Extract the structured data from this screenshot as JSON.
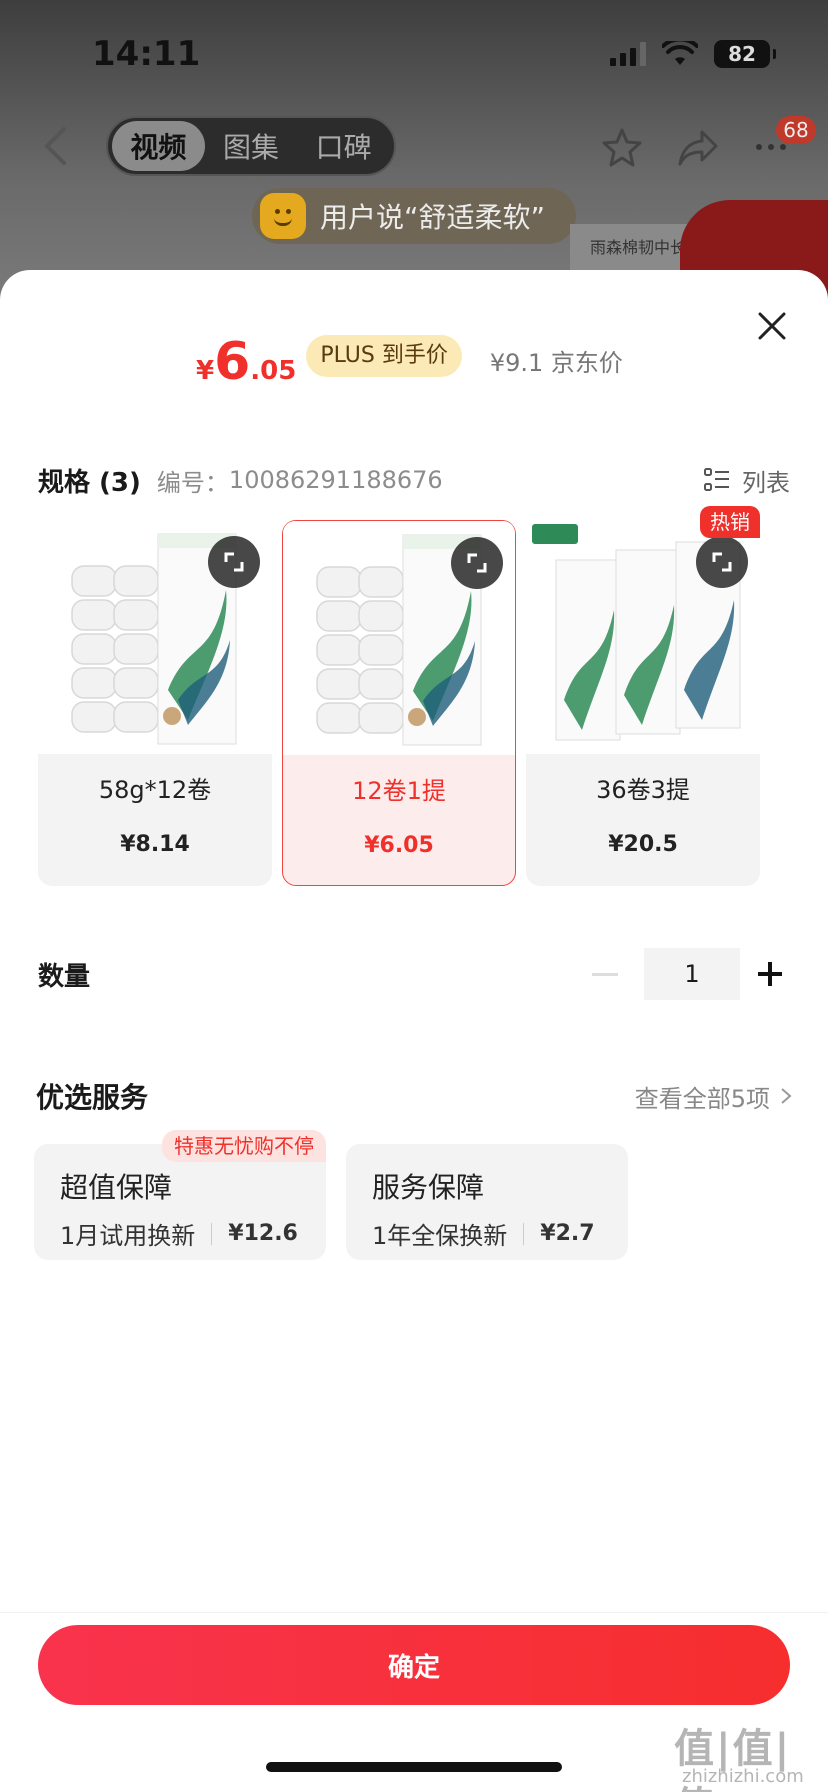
{
  "status_bar": {
    "time": "14:11",
    "battery": "82"
  },
  "nav": {
    "tabs": [
      {
        "label": "视频"
      },
      {
        "label": "图集"
      },
      {
        "label": "口碑"
      }
    ],
    "badge_count": "68"
  },
  "user_say": {
    "text": "用户说“舒适柔软”"
  },
  "background": {
    "product_label": "雨森棉韧中长"
  },
  "price": {
    "yen": "¥",
    "integer": "6",
    "decimal": ".05",
    "plus_tag": "PLUS 到手价",
    "jd_price": "¥9.1 京东价"
  },
  "spec": {
    "title": "规格 (3)",
    "code_label": "编号：",
    "code": "10086291188676",
    "list_label": "列表",
    "items": [
      {
        "name": "58g*12卷",
        "price": "¥8.14"
      },
      {
        "name": "12卷1提",
        "price": "¥6.05",
        "selected": true
      },
      {
        "name": "36卷3提",
        "price": "¥20.5",
        "badge": "热销"
      }
    ]
  },
  "quantity": {
    "label": "数量",
    "value": "1"
  },
  "service": {
    "title": "优选服务",
    "more": "查看全部5项",
    "items": [
      {
        "name": "超值保障",
        "desc": "1月试用换新",
        "price": "¥12.6",
        "badge": "特惠无忧购不停"
      },
      {
        "name": "服务保障",
        "desc": "1年全保换新",
        "price": "¥2.7"
      }
    ]
  },
  "confirm_label": "确定",
  "watermark": {
    "main": "值|值|值",
    "sub": "zhizhizhi.com"
  },
  "colors": {
    "accent": "#f0302b",
    "plus_tag_bg": "#fbe9b6"
  }
}
